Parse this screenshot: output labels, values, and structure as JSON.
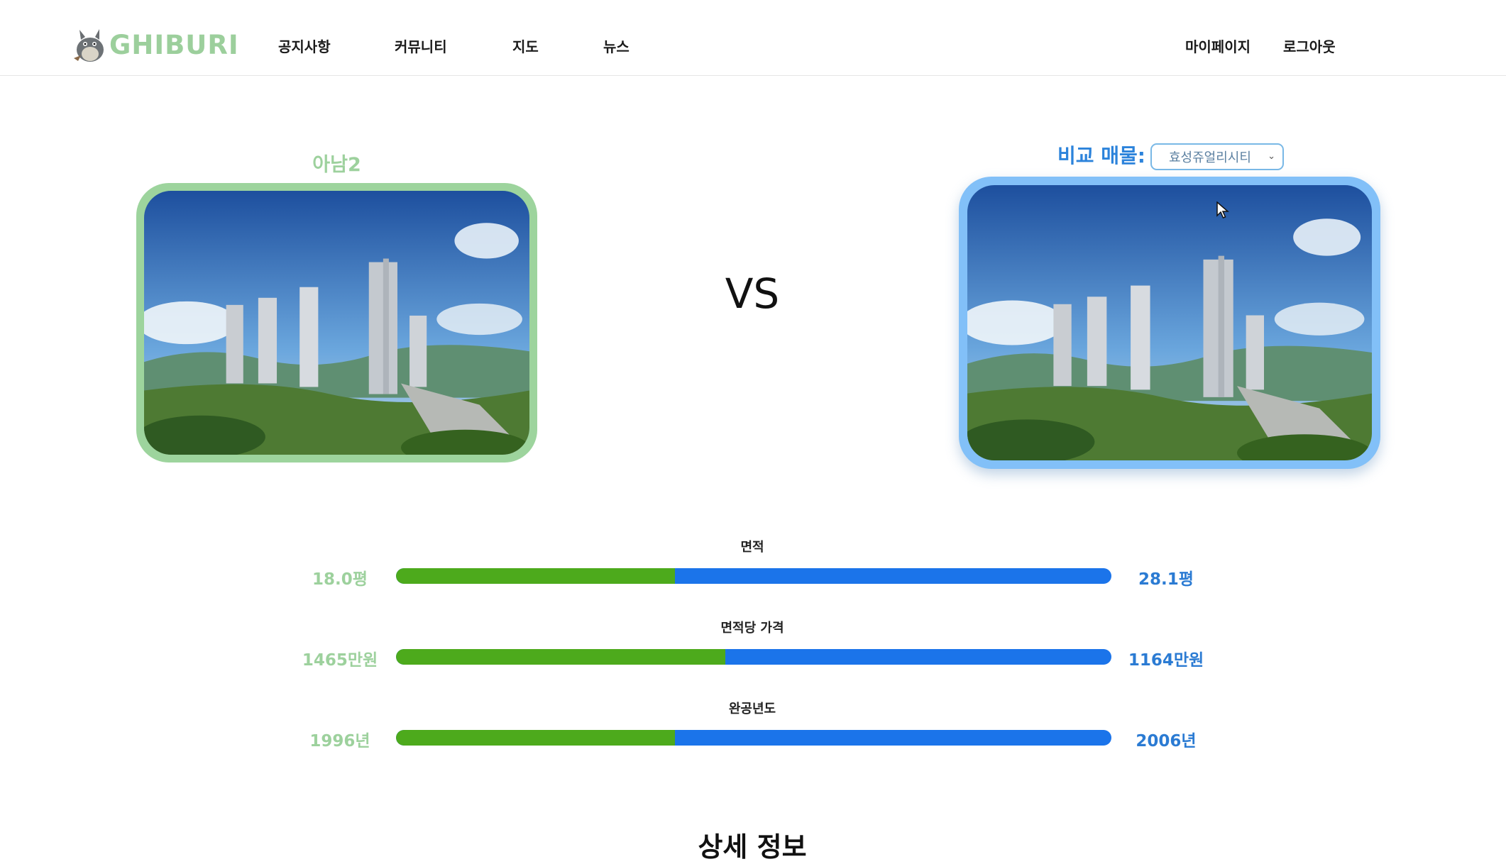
{
  "header": {
    "logo_text": "GHIBURI",
    "nav": [
      "공지사항",
      "커뮤니티",
      "지도",
      "뉴스"
    ],
    "mypage": "마이페이지",
    "logout": "로그아웃"
  },
  "compare": {
    "left_name": "아남2",
    "vs": "VS",
    "right_label": "비교 매물:",
    "right_selected": "효성쥬얼리시티",
    "left_color": "#9dd49d",
    "right_color": "#82c0f8"
  },
  "metrics": [
    {
      "title": "면적",
      "left": "18.0평",
      "right": "28.1평",
      "left_share": 0.39
    },
    {
      "title": "면적당 가격",
      "left": "1465만원",
      "right": "1164만원",
      "left_share": 0.46
    },
    {
      "title": "완공년도",
      "left": "1996년",
      "right": "2006년",
      "left_share": 0.39
    }
  ],
  "section_title": "상세 정보"
}
